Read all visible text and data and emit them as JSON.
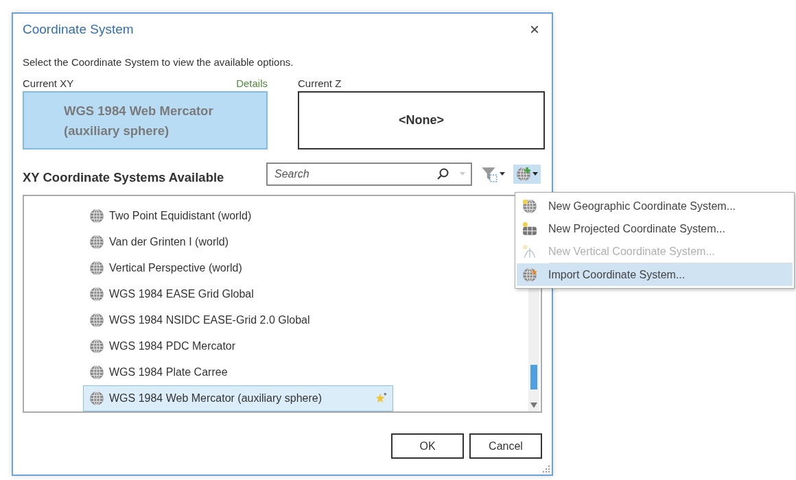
{
  "window": {
    "title": "Coordinate System",
    "close": "×"
  },
  "instruction": "Select the Coordinate System to view the available options.",
  "current_xy": {
    "label": "Current XY",
    "details_link": "Details",
    "value": "WGS 1984 Web Mercator (auxiliary sphere)"
  },
  "current_z": {
    "label": "Current Z",
    "value": "<None>"
  },
  "available": {
    "heading": "XY Coordinate Systems Available",
    "search": {
      "placeholder": "Search"
    },
    "add_menu_expanded": true
  },
  "systems": [
    {
      "name": "Two Point Equidistant (world)",
      "selected": false,
      "favorite": false
    },
    {
      "name": "Van der Grinten I (world)",
      "selected": false,
      "favorite": false
    },
    {
      "name": "Vertical Perspective (world)",
      "selected": false,
      "favorite": false
    },
    {
      "name": "WGS 1984 EASE Grid Global",
      "selected": false,
      "favorite": false
    },
    {
      "name": "WGS 1984 NSIDC EASE-Grid 2.0 Global",
      "selected": false,
      "favorite": false
    },
    {
      "name": "WGS 1984 PDC Mercator",
      "selected": false,
      "favorite": false
    },
    {
      "name": "WGS 1984 Plate Carree",
      "selected": false,
      "favorite": false
    },
    {
      "name": "WGS 1984 Web Mercator (auxiliary sphere)",
      "selected": true,
      "favorite": true
    }
  ],
  "add_menu": [
    {
      "kind": "geographic",
      "label": "New Geographic Coordinate System...",
      "disabled": false,
      "selected": false
    },
    {
      "kind": "projected",
      "label": "New Projected Coordinate System...",
      "disabled": false,
      "selected": false
    },
    {
      "kind": "vertical",
      "label": "New Vertical Coordinate System...",
      "disabled": true,
      "selected": false
    },
    {
      "kind": "import",
      "label": "Import Coordinate System...",
      "disabled": false,
      "selected": true
    }
  ],
  "buttons": [
    "OK",
    "Cancel"
  ]
}
